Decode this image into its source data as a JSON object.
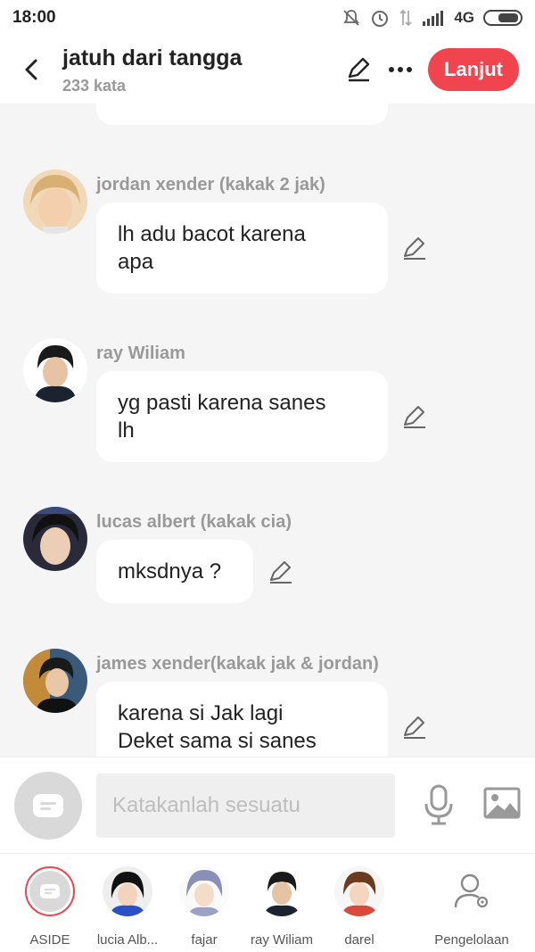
{
  "status_bar": {
    "time": "18:00",
    "network": "4G"
  },
  "header": {
    "title": "jatuh dari tangga",
    "word_count": "233 kata",
    "next_label": "Lanjut"
  },
  "messages": [
    {
      "sender": "jordan xender (kakak 2 jak)",
      "text_lines": [
        "lh adu bacot karena",
        "apa"
      ]
    },
    {
      "sender": "ray Wiliam",
      "text_lines": [
        "yg pasti karena sanes",
        "lh"
      ]
    },
    {
      "sender": "lucas albert (kakak cia)",
      "text_lines": [
        "mksdnya ?"
      ]
    },
    {
      "sender": "james xender(kakak jak & jordan)",
      "text_lines": [
        "karena si Jak lagi",
        "Deket sama si sanes"
      ]
    }
  ],
  "input": {
    "placeholder": "Katakanlah sesuatu"
  },
  "characters": [
    {
      "label": "ASIDE"
    },
    {
      "label": "lucia Alb..."
    },
    {
      "label": "fajar"
    },
    {
      "label": "ray Wiliam"
    },
    {
      "label": "darel"
    },
    {
      "label": "Pengelolaan"
    }
  ],
  "colors": {
    "accent": "#f0444e",
    "background": "#f5f5f5"
  }
}
